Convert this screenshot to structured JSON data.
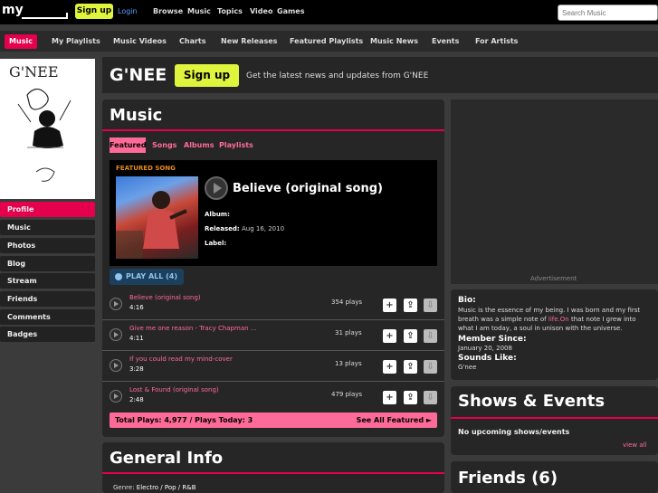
{
  "topbar": {
    "signup": "Sign up",
    "login": "Login",
    "nav": [
      "Browse",
      "Music",
      "Topics",
      "Video",
      "Games"
    ],
    "search_placeholder": "Search Music"
  },
  "subnav": [
    "Music",
    "My Playlists",
    "Music Videos",
    "Charts",
    "New Releases",
    "Featured Playlists",
    "Music News",
    "Events",
    "For Artists"
  ],
  "artist": {
    "name": "G'NEE",
    "signup": "Sign up",
    "tagline": "Get the latest news and updates from G'NEE",
    "photo_caption": "G'NEE"
  },
  "sidebar": [
    "Profile",
    "Music",
    "Photos",
    "Blog",
    "Stream",
    "Friends",
    "Comments",
    "Badges"
  ],
  "music": {
    "title": "Music",
    "tabs": [
      "Featured",
      "Songs",
      "Albums",
      "Playlists"
    ],
    "featured_label": "FEATURED SONG",
    "featured_title": "Believe (original song)",
    "album_label": "Album:",
    "released_label": "Released:",
    "released_value": "Aug 16, 2010",
    "label_label": "Label:",
    "play_all": "PLAY ALL (4)",
    "tracks": [
      {
        "title": "Believe (original song)",
        "duration": "4:16",
        "plays": "354 plays"
      },
      {
        "title": "Give me one reason - Tracy Chapman ...",
        "duration": "4:11",
        "plays": "31 plays"
      },
      {
        "title": "If you could read my mind-cover",
        "duration": "3:28",
        "plays": "13 plays"
      },
      {
        "title": "Lost & Found (original song)",
        "duration": "2:48",
        "plays": "479 plays"
      }
    ],
    "totals": "Total Plays: 4,977 / Plays Today: 3",
    "see_all": "See All Featured ►"
  },
  "general_info": {
    "title": "General Info",
    "genre_label": "Genre:",
    "genre_value": "Electro / Pop / R&B"
  },
  "ad": {
    "label": "Advertisement"
  },
  "bio": {
    "bio_head": "Bio:",
    "bio_text_1": "Music is the essence of my being. I was born and my first",
    "bio_text_2a": "breath was a simple note of ",
    "bio_text_2b": "life.On",
    "bio_text_2c": " that note I grew into",
    "bio_text_3": "what I am today, a soul in unison with the universe.",
    "member_head": "Member Since:",
    "member_value": "January 20, 2008",
    "sounds_head": "Sounds Like:",
    "sounds_value": "G'nee"
  },
  "shows": {
    "title": "Shows & Events",
    "empty": "No upcoming shows/events",
    "view_all": "view all"
  },
  "friends": {
    "title": "Friends (6)"
  },
  "colors": {
    "accent": "#e4004d",
    "pink": "#ff6b98",
    "lime": "#dff53d"
  }
}
